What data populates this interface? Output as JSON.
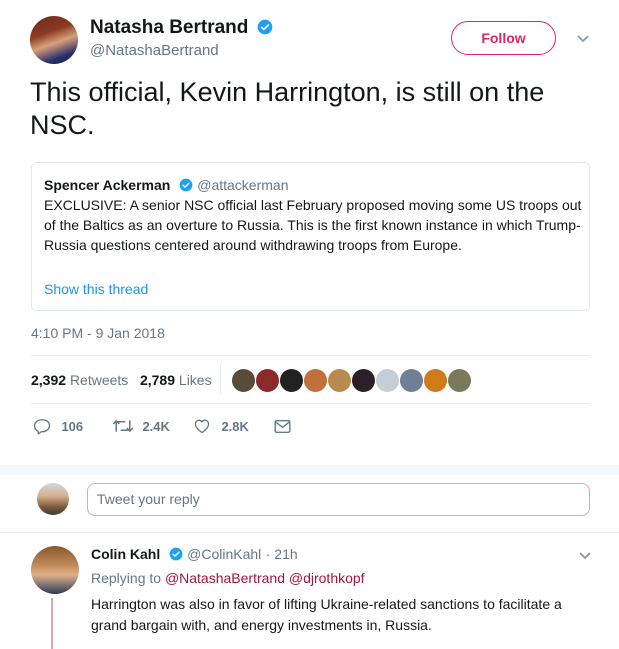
{
  "tweet": {
    "author_name": "Natasha Bertrand",
    "author_handle": "@NatashaBertrand",
    "follow_label": "Follow",
    "text": "This official, Kevin Harrington, is still on the NSC.",
    "timestamp": "4:10 PM - 9 Jan 2018",
    "retweets_count": "2,392",
    "retweets_label": "Retweets",
    "likes_count": "2,789",
    "likes_label": "Likes",
    "actions": {
      "reply": "106",
      "retweet": "2.4K",
      "like": "2.8K"
    }
  },
  "quote": {
    "author_name": "Spencer Ackerman",
    "author_handle": "@attackerman",
    "text": "EXCLUSIVE: A senior NSC official last February proposed moving some US troops out of the Baltics as an overture to Russia. This is the first known instance in which Trump-Russia questions centered around withdrawing troops from Europe.",
    "show_thread": "Show this thread"
  },
  "reply_box": {
    "placeholder": "Tweet your reply"
  },
  "reply": {
    "author_name": "Colin Kahl",
    "author_handle": "@ColinKahl",
    "time": "· 21h",
    "replying_prefix": "Replying to",
    "replying_users": "@NatashaBertrand @djrothkopf",
    "text": "Harrington was also in favor of lifting Ukraine-related sanctions to facilitate a grand bargain with, and energy investments in, Russia."
  },
  "colors": {
    "verified": "#1da1f2",
    "follow": "#e0245e",
    "muted": "#657786",
    "link": "#1b95e0",
    "reply_link": "#a0163f"
  }
}
